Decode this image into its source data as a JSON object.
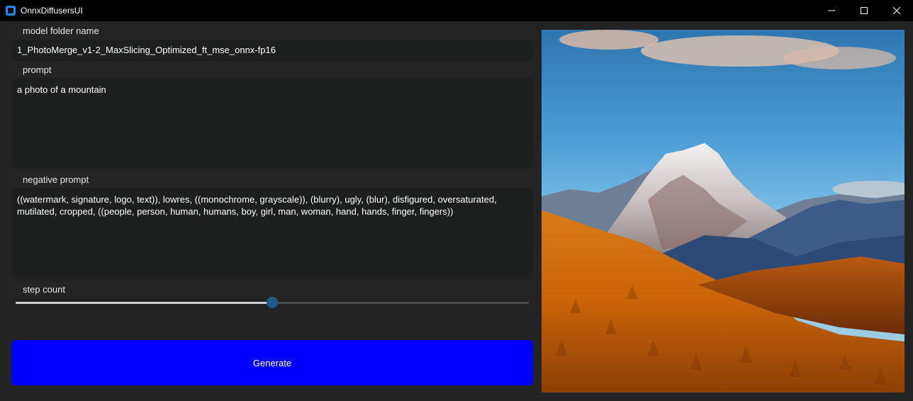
{
  "window": {
    "title": "OnnxDiffusersUI",
    "controls": [
      "minimize",
      "maximize",
      "close"
    ]
  },
  "model": {
    "label": "model folder name",
    "value": "1_PhotoMerge_v1-2_MaxSlicing_Optimized_ft_mse_onnx-fp16"
  },
  "prompt": {
    "label": "prompt",
    "value": "a photo of a mountain"
  },
  "negative_prompt": {
    "label": "negative prompt",
    "value": "((watermark, signature, logo, text)), lowres, ((monochrome, grayscale)), (blurry), ugly, (blur), disfigured, oversaturated, mutilated, cropped, ((people, person, human, humans, boy, girl, man, woman, hand, hands, finger, fingers))"
  },
  "step_count": {
    "label": "step count",
    "position_fraction": 0.5
  },
  "generate_button": {
    "label": "Generate"
  },
  "colors": {
    "titlebar": "#000000",
    "background": "#232323",
    "field_bg": "#1d1e1e",
    "button": "#0000ff",
    "slider_thumb": "#1f5a8c"
  },
  "image": {
    "subject": "mountain-landscape-image"
  }
}
